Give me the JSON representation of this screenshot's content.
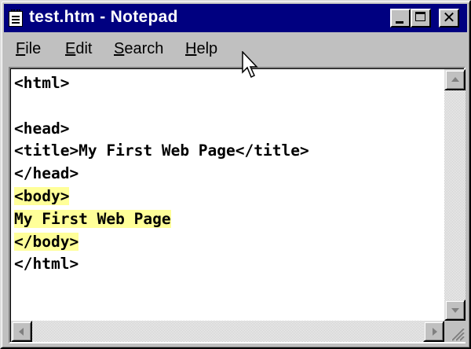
{
  "window": {
    "title": "test.htm - Notepad",
    "icon": "notepad-icon"
  },
  "title_buttons": {
    "minimize_icon": "minimize-icon",
    "maximize_icon": "maximize-icon",
    "close_glyph": "✕"
  },
  "menu": {
    "items": [
      {
        "access_key": "F",
        "rest": "ile"
      },
      {
        "access_key": "E",
        "rest": "dit"
      },
      {
        "access_key": "S",
        "rest": "earch"
      },
      {
        "access_key": "H",
        "rest": "elp"
      }
    ]
  },
  "document": {
    "lines": [
      {
        "text": "<html>",
        "highlighted": false
      },
      {
        "text": "",
        "highlighted": false
      },
      {
        "text": "<head>",
        "highlighted": false
      },
      {
        "text": "<title>My First Web Page</title>",
        "highlighted": false
      },
      {
        "text": "</head>",
        "highlighted": false
      },
      {
        "text": "<body>",
        "highlighted": true
      },
      {
        "text": "My First Web Page",
        "highlighted": true
      },
      {
        "text": "</body>",
        "highlighted": true
      },
      {
        "text": "</html>",
        "highlighted": false
      }
    ]
  },
  "colors": {
    "titlebar": "#000080",
    "highlight": "#ffff99",
    "chrome": "#c0c0c0"
  },
  "cursor": {
    "icon": "arrow-cursor-icon"
  }
}
